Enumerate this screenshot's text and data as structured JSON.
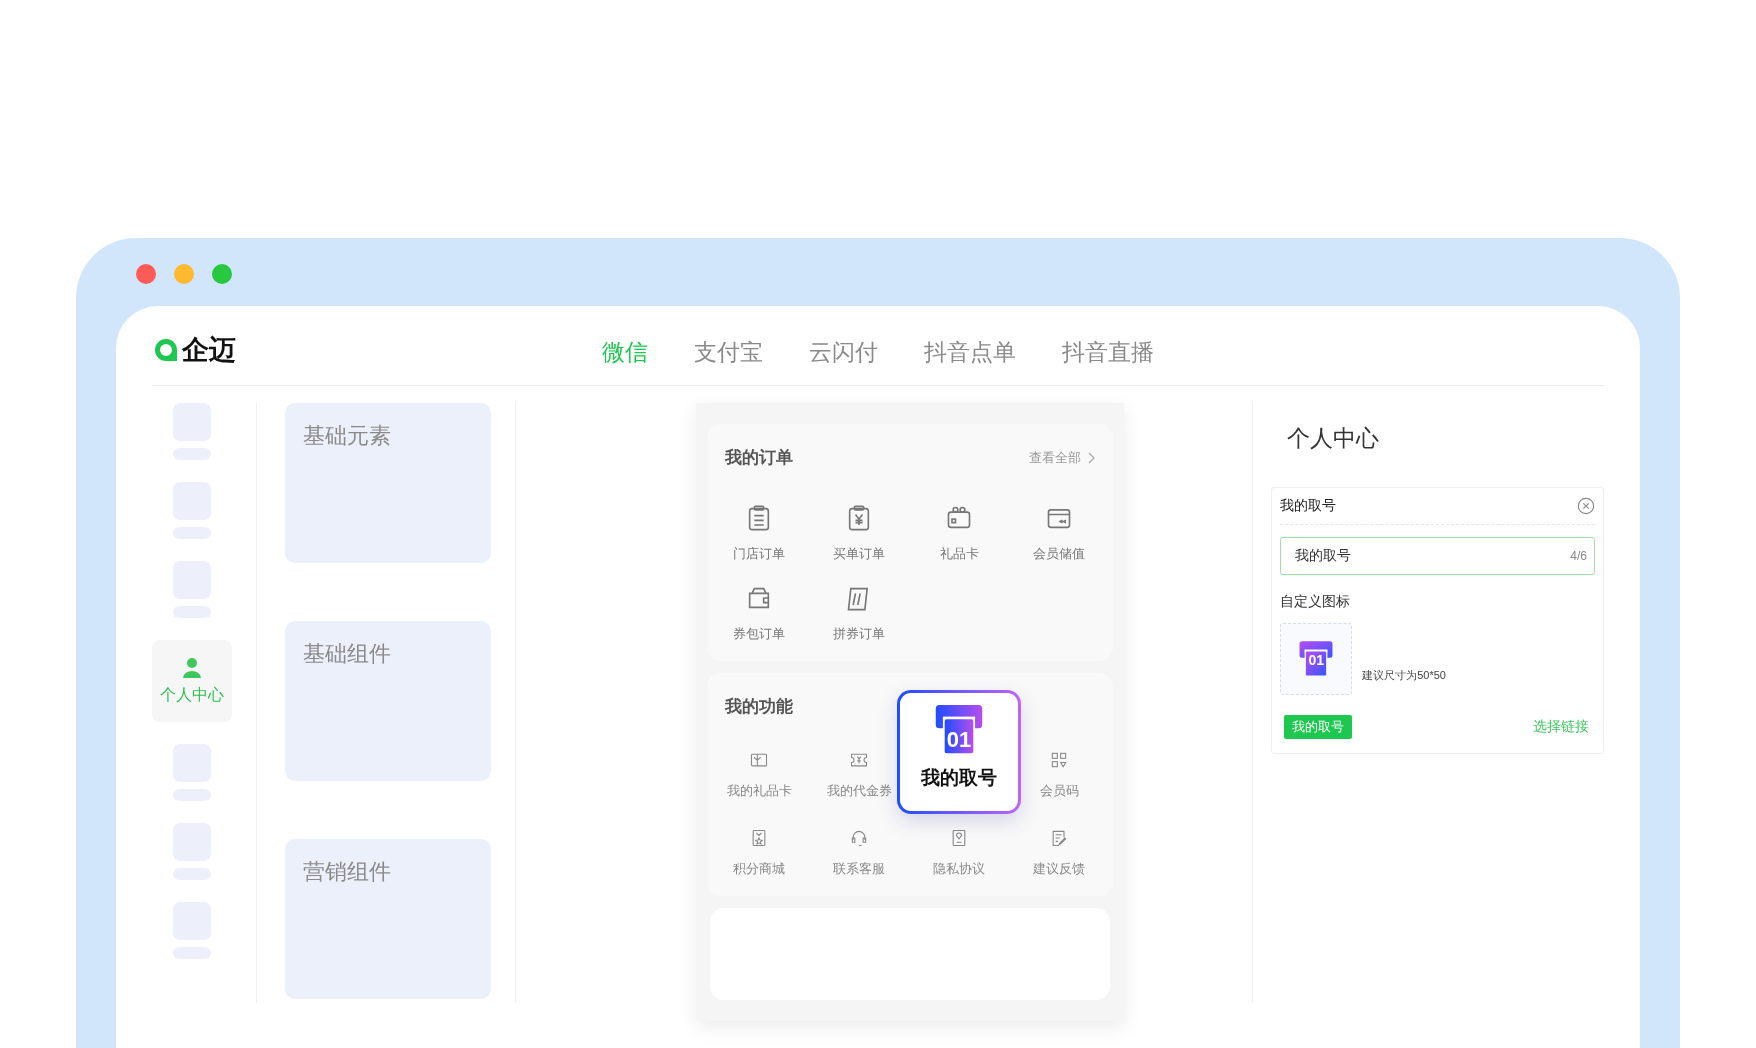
{
  "brand": "企迈",
  "tabs": [
    {
      "label": "微信",
      "selected": true
    },
    {
      "label": "支付宝",
      "selected": false
    },
    {
      "label": "云闪付",
      "selected": false
    },
    {
      "label": "抖音点单",
      "selected": false
    },
    {
      "label": "抖音直播",
      "selected": false
    }
  ],
  "sidebar": {
    "items": [
      {
        "selected": false
      },
      {
        "selected": false
      },
      {
        "selected": false
      },
      {
        "label": "个人中心",
        "selected": true
      },
      {
        "selected": false
      },
      {
        "selected": false
      },
      {
        "selected": false
      }
    ]
  },
  "categories": [
    {
      "label": "基础元素"
    },
    {
      "label": "基础组件"
    },
    {
      "label": "营销组件"
    }
  ],
  "preview": {
    "orders": {
      "title": "我的订单",
      "more": "查看全部",
      "items": [
        {
          "label": "门店订单"
        },
        {
          "label": "买单订单"
        },
        {
          "label": "礼品卡"
        },
        {
          "label": "会员储值"
        },
        {
          "label": "券包订单"
        },
        {
          "label": "拼券订单"
        }
      ]
    },
    "functions": {
      "title": "我的功能",
      "items": [
        {
          "label": "我的礼品卡",
          "highlighted": false
        },
        {
          "label": "我的代金券",
          "highlighted": false
        },
        {
          "label": "我的取号",
          "highlighted": true,
          "number": "01"
        },
        {
          "label": "会员码",
          "highlighted": false
        },
        {
          "label": "积分商城",
          "highlighted": false
        },
        {
          "label": "联系客服",
          "highlighted": false
        },
        {
          "label": "隐私协议",
          "highlighted": false
        },
        {
          "label": "建议反馈",
          "highlighted": false
        }
      ]
    }
  },
  "settings": {
    "title": "个人中心",
    "card_title": "我的取号",
    "name_field": {
      "value": "我的取号",
      "counter": "4/6"
    },
    "icon_section": "自定义图标",
    "icon_number": "01",
    "icon_hint": "建议尺寸为50*50",
    "tag": "我的取号",
    "link": "选择链接"
  }
}
